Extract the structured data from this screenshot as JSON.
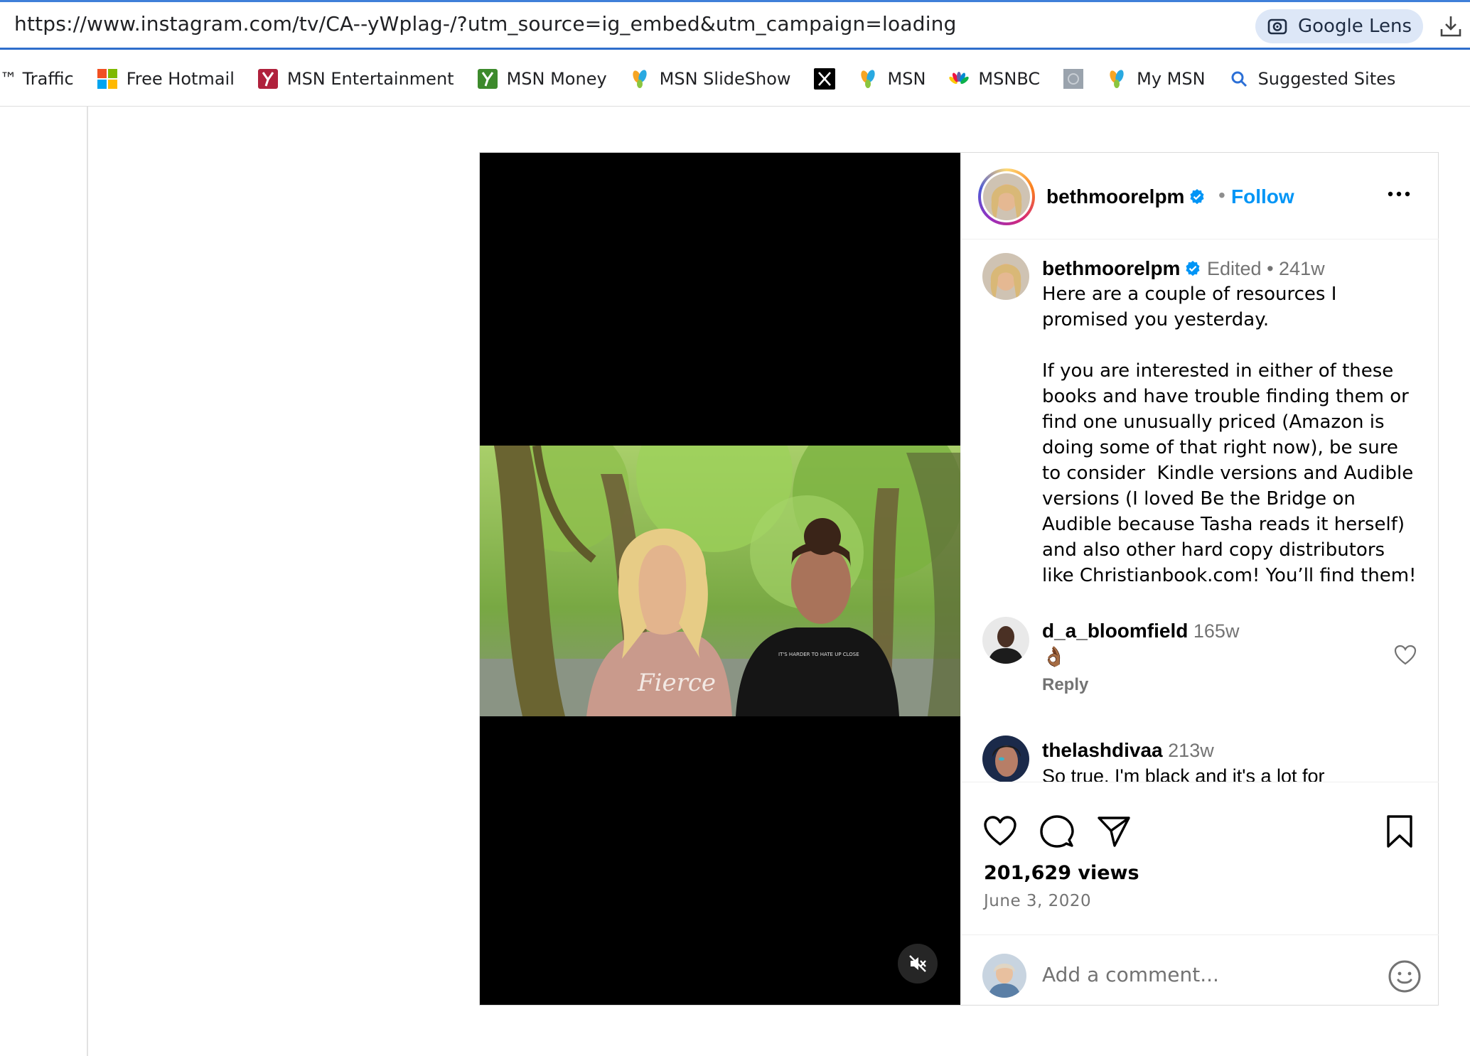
{
  "browser": {
    "url": "https://www.instagram.com/tv/CA--yWplag-/?utm_source=ig_embed&utm_campaign=loading",
    "lens_label": "Google Lens",
    "bookmarks": [
      {
        "label": "™ Traffic",
        "icon": "none"
      },
      {
        "label": "Free Hotmail",
        "icon": "windows-logo-icon"
      },
      {
        "label": "MSN Entertainment",
        "icon": "msn-y-icon"
      },
      {
        "label": "MSN Money",
        "icon": "msn-money-icon"
      },
      {
        "label": "MSN SlideShow",
        "icon": "msn-butterfly-icon"
      },
      {
        "label": "",
        "icon": "x-logo-icon"
      },
      {
        "label": "MSN",
        "icon": "msn-butterfly-icon"
      },
      {
        "label": "MSNBC",
        "icon": "peacock-icon"
      },
      {
        "label": "",
        "icon": "generic-page-icon"
      },
      {
        "label": "My MSN",
        "icon": "msn-butterfly-icon"
      },
      {
        "label": "Suggested Sites",
        "icon": "search-icon"
      }
    ]
  },
  "post": {
    "username": "bethmoorelpm",
    "follow_label": "Follow",
    "dot": "•",
    "caption": {
      "username": "bethmoorelpm",
      "edited": "Edited",
      "sep": "•",
      "age": "241w",
      "text": "Here are a couple of resources I\npromised you yesterday.\n\nIf you are interested in either of these\nbooks and have trouble finding them or\nfind one unusually priced (Amazon is\ndoing some of that right now), be sure\nto consider  Kindle versions and Audible\nversions (I loved Be the Bridge on\nAudible because Tasha reads it herself)\nand also other hard copy distributors\nlike Christianbook.com! You’ll find them!"
    },
    "comments": [
      {
        "username": "d_a_bloomfield",
        "age": "165w",
        "text": "👌🏾",
        "reply_label": "Reply"
      },
      {
        "username": "thelashdivaa",
        "age": "213w",
        "text": "So true. I'm black and it's a lot for"
      }
    ],
    "views": "201,629 views",
    "date": "June 3, 2020",
    "comment_placeholder": "Add a comment..."
  },
  "colors": {
    "accent": "#0095f6",
    "verified": "#0095f6",
    "muted": "#737373"
  }
}
